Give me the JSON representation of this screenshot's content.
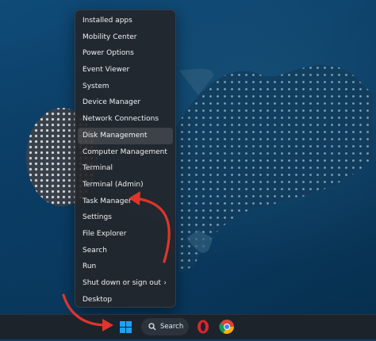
{
  "menu": {
    "items": [
      {
        "label": "Installed apps"
      },
      {
        "label": "Mobility Center"
      },
      {
        "label": "Power Options"
      },
      {
        "label": "Event Viewer"
      },
      {
        "label": "System"
      },
      {
        "label": "Device Manager"
      },
      {
        "label": "Network Connections"
      },
      {
        "label": "Disk Management"
      },
      {
        "label": "Computer Management"
      },
      {
        "label": "Terminal"
      },
      {
        "label": "Terminal (Admin)"
      },
      {
        "label": "Task Manager"
      },
      {
        "label": "Settings"
      },
      {
        "label": "File Explorer"
      },
      {
        "label": "Search"
      },
      {
        "label": "Run"
      },
      {
        "label": "Shut down or sign out"
      },
      {
        "label": "Desktop"
      }
    ]
  },
  "taskbar": {
    "search_label": "Search"
  },
  "colors": {
    "annotation_arrow": "#e0342c",
    "accent_windows_blue": "#1fa0f0",
    "menu_background": "#24262a"
  },
  "icons": [
    "windows-start-icon",
    "search-icon",
    "opera-icon",
    "chrome-icon",
    "chevron-right-icon"
  ]
}
